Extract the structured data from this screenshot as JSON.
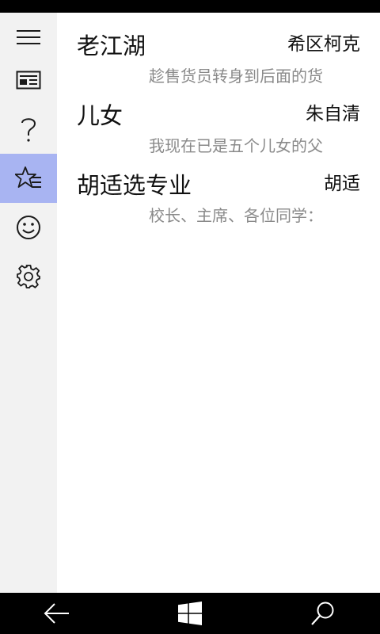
{
  "sidebar": {
    "items": [
      {
        "icon": "hamburger-menu-icon"
      },
      {
        "icon": "news-icon"
      },
      {
        "icon": "question-mark-icon"
      },
      {
        "icon": "favorites-list-icon",
        "active": true
      },
      {
        "icon": "smiley-icon"
      },
      {
        "icon": "gear-icon"
      }
    ],
    "active_color": "#a8b4f2"
  },
  "articles": [
    {
      "title": "老江湖",
      "author": "希区柯克",
      "preview": "趁售货员转身到后面的货"
    },
    {
      "title": "儿女",
      "author": "朱自清",
      "preview": "我现在已是五个儿女的父"
    },
    {
      "title": "胡适选专业",
      "author": "胡适",
      "preview": "校长、主席、各位同学："
    }
  ],
  "nav_bar": {
    "items": [
      {
        "icon": "back-arrow-icon"
      },
      {
        "icon": "windows-logo-icon"
      },
      {
        "icon": "search-icon"
      }
    ]
  }
}
